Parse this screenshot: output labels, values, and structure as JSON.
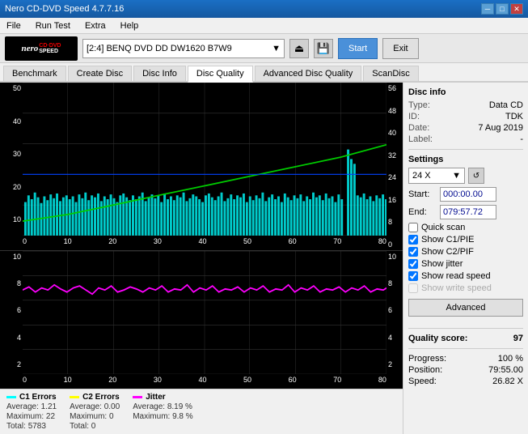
{
  "titlebar": {
    "title": "Nero CD-DVD Speed 4.7.7.16",
    "min_btn": "─",
    "max_btn": "□",
    "close_btn": "✕"
  },
  "menu": {
    "items": [
      "File",
      "Run Test",
      "Extra",
      "Help"
    ]
  },
  "toolbar": {
    "drive_label": "[2:4]  BENQ DVD DD DW1620 B7W9",
    "start_label": "Start",
    "exit_label": "Exit"
  },
  "tabs": [
    {
      "label": "Benchmark"
    },
    {
      "label": "Create Disc"
    },
    {
      "label": "Disc Info"
    },
    {
      "label": "Disc Quality",
      "active": true
    },
    {
      "label": "Advanced Disc Quality"
    },
    {
      "label": "ScanDisc"
    }
  ],
  "disc_info": {
    "section": "Disc info",
    "type_label": "Type:",
    "type_value": "Data CD",
    "id_label": "ID:",
    "id_value": "TDK",
    "date_label": "Date:",
    "date_value": "7 Aug 2019",
    "label_label": "Label:",
    "label_value": "-"
  },
  "settings": {
    "section": "Settings",
    "speed_label": "24 X",
    "start_label": "Start:",
    "start_value": "000:00.00",
    "end_label": "End:",
    "end_value": "079:57.72",
    "quick_scan": false,
    "show_c1_pie": true,
    "show_c2_pif": true,
    "show_jitter": true,
    "show_read_speed": true,
    "show_write_speed": false,
    "quick_scan_label": "Quick scan",
    "c1_pie_label": "Show C1/PIE",
    "c2_pif_label": "Show C2/PIF",
    "jitter_label": "Show jitter",
    "read_speed_label": "Show read speed",
    "write_speed_label": "Show write speed",
    "advanced_label": "Advanced"
  },
  "quality": {
    "score_label": "Quality score:",
    "score_value": "97",
    "progress_label": "Progress:",
    "progress_value": "100 %",
    "position_label": "Position:",
    "position_value": "79:55.00",
    "speed_label": "Speed:",
    "speed_value": "26.82 X"
  },
  "legend": {
    "c1": {
      "title": "C1 Errors",
      "color": "#00ffff",
      "avg_label": "Average:",
      "avg_value": "1.21",
      "max_label": "Maximum:",
      "max_value": "22",
      "total_label": "Total:",
      "total_value": "5783"
    },
    "c2": {
      "title": "C2 Errors",
      "color": "#ffff00",
      "avg_label": "Average:",
      "avg_value": "0.00",
      "max_label": "Maximum:",
      "max_value": "0",
      "total_label": "Total:",
      "total_value": "0"
    },
    "jitter": {
      "title": "Jitter",
      "color": "#ff00ff",
      "avg_label": "Average:",
      "avg_value": "8.19 %",
      "max_label": "Maximum:",
      "max_value": "9.8 %"
    }
  },
  "upper_chart": {
    "y_left": [
      "50",
      "40",
      "30",
      "20",
      "10"
    ],
    "y_right": [
      "56",
      "48",
      "40",
      "32",
      "24",
      "16",
      "8",
      "0"
    ],
    "x": [
      "0",
      "10",
      "20",
      "30",
      "40",
      "50",
      "60",
      "70",
      "80"
    ]
  },
  "lower_chart": {
    "y_left": [
      "10",
      "8",
      "6",
      "4",
      "2"
    ],
    "y_right": [
      "10",
      "8",
      "6",
      "4",
      "2"
    ],
    "x": [
      "0",
      "10",
      "20",
      "30",
      "40",
      "50",
      "60",
      "70",
      "80"
    ]
  }
}
